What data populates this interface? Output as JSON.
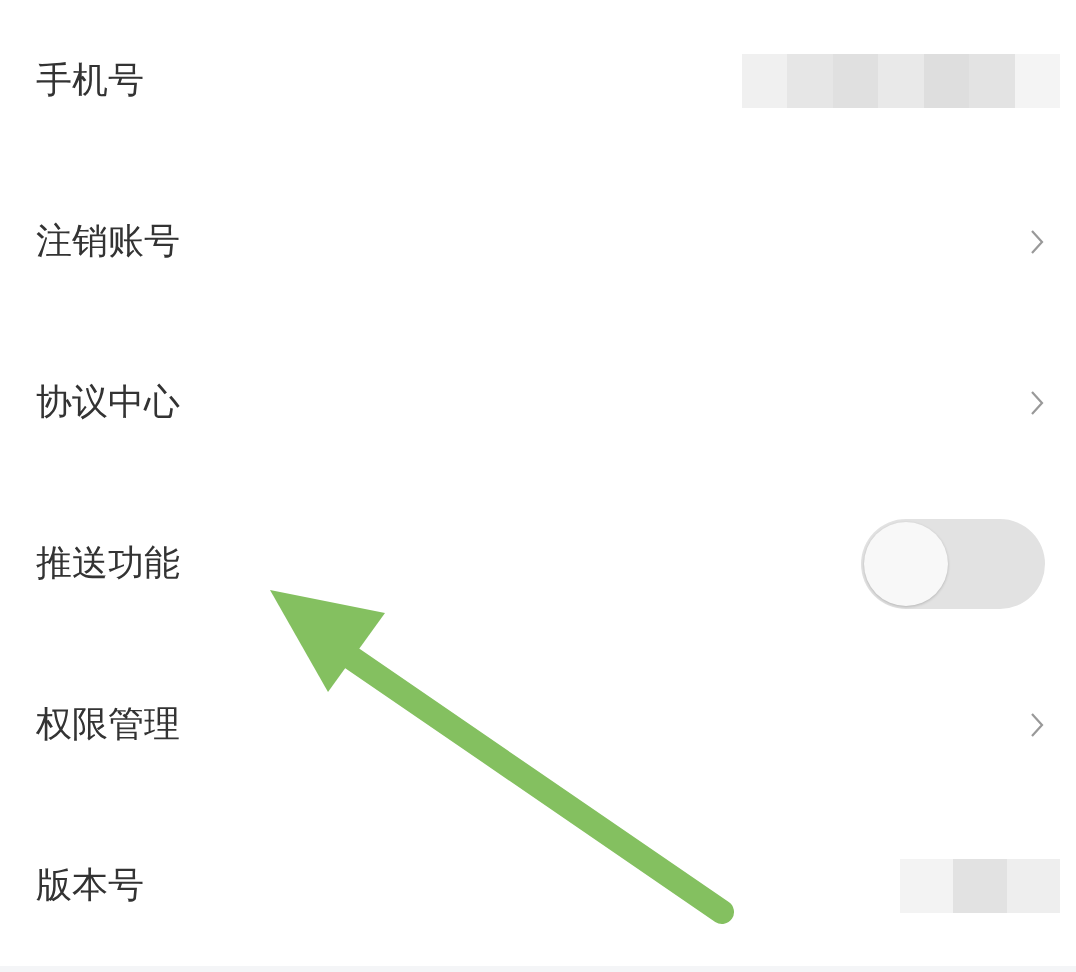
{
  "settings": [
    {
      "kind": "redacted",
      "label": "手机号"
    },
    {
      "kind": "link",
      "label": "注销账号"
    },
    {
      "kind": "link",
      "label": "协议中心"
    },
    {
      "kind": "toggle",
      "label": "推送功能",
      "on": false
    },
    {
      "kind": "link",
      "label": "权限管理"
    },
    {
      "kind": "redacted-short",
      "label": "版本号"
    }
  ]
}
